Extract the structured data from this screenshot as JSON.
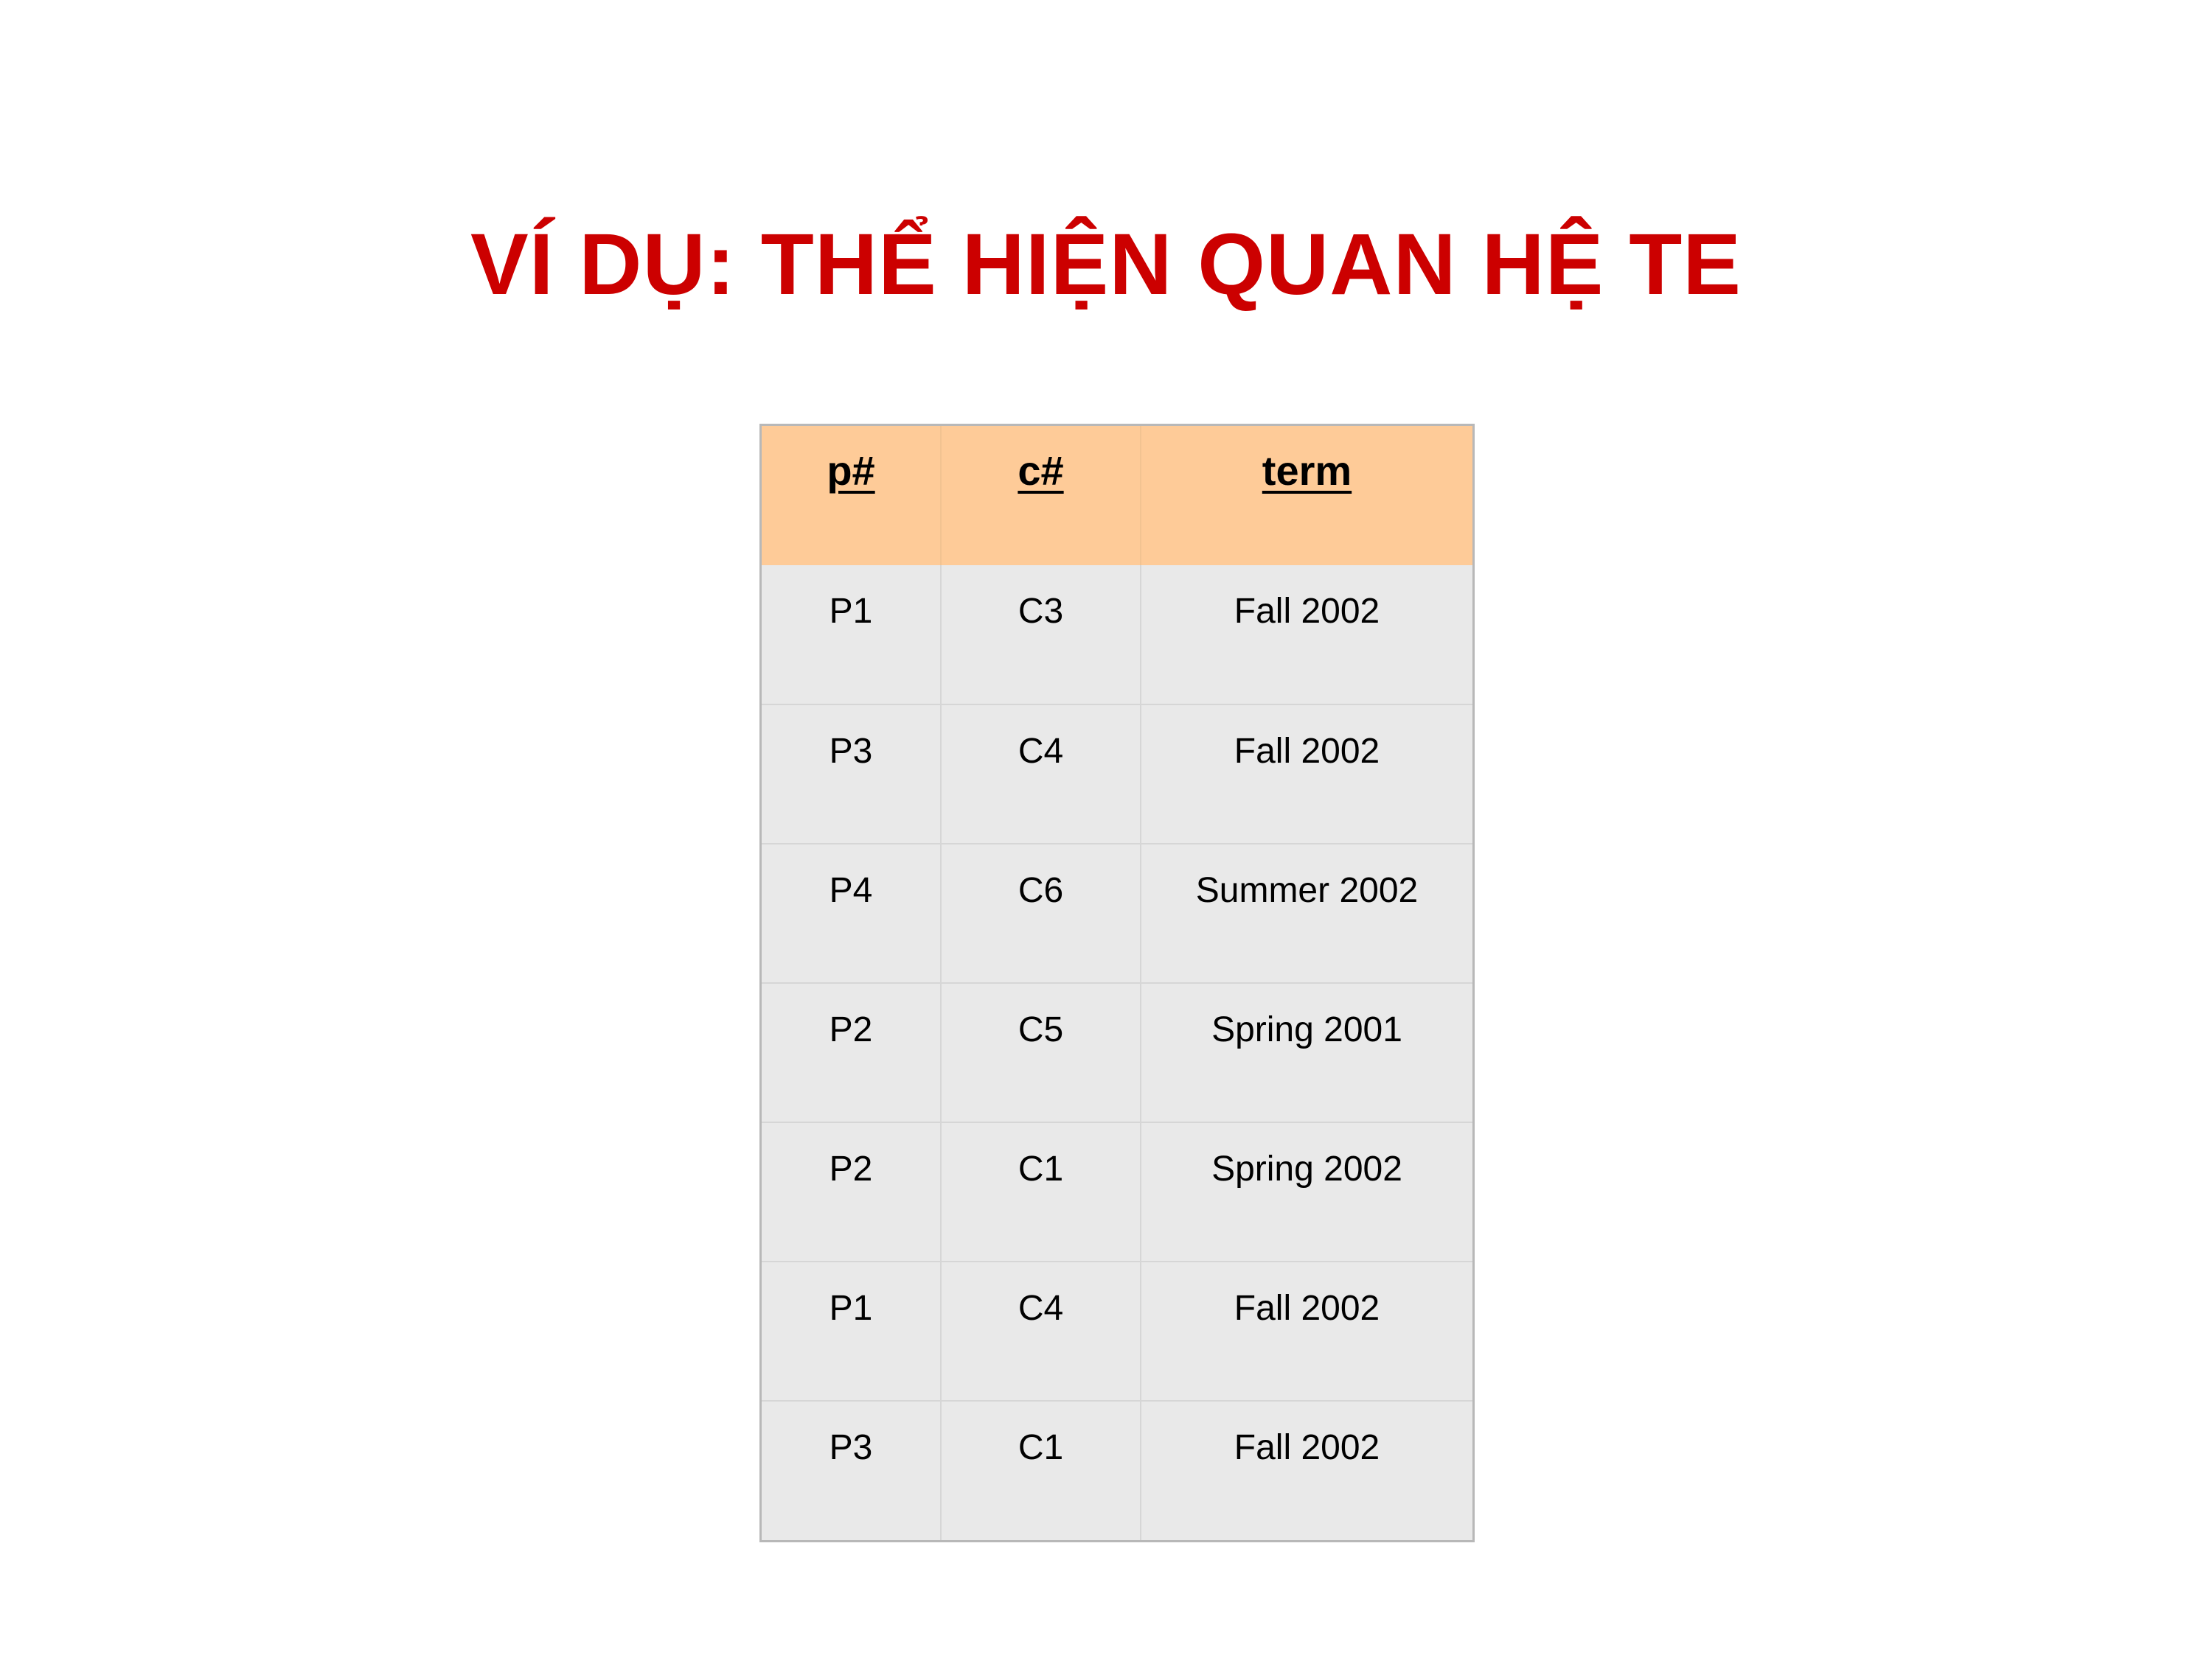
{
  "slide": {
    "title": "VÍ DỤ: THỂ HIỆN QUAN HỆ TE"
  },
  "table": {
    "headers": [
      "p#",
      "c#",
      "term"
    ],
    "rows": [
      [
        "P1",
        "C3",
        "Fall 2002"
      ],
      [
        "P3",
        "C4",
        "Fall 2002"
      ],
      [
        "P4",
        "C6",
        "Summer 2002"
      ],
      [
        "P2",
        "C5",
        "Spring 2001"
      ],
      [
        "P2",
        "C1",
        "Spring 2002"
      ],
      [
        "P1",
        "C4",
        "Fall 2002"
      ],
      [
        "P3",
        "C1",
        "Fall 2002"
      ]
    ]
  },
  "colors": {
    "title": "#cc0000",
    "header_background": "#fecb98",
    "body_background": "#e9e9e9",
    "grid_line": "#d6d6d6"
  }
}
